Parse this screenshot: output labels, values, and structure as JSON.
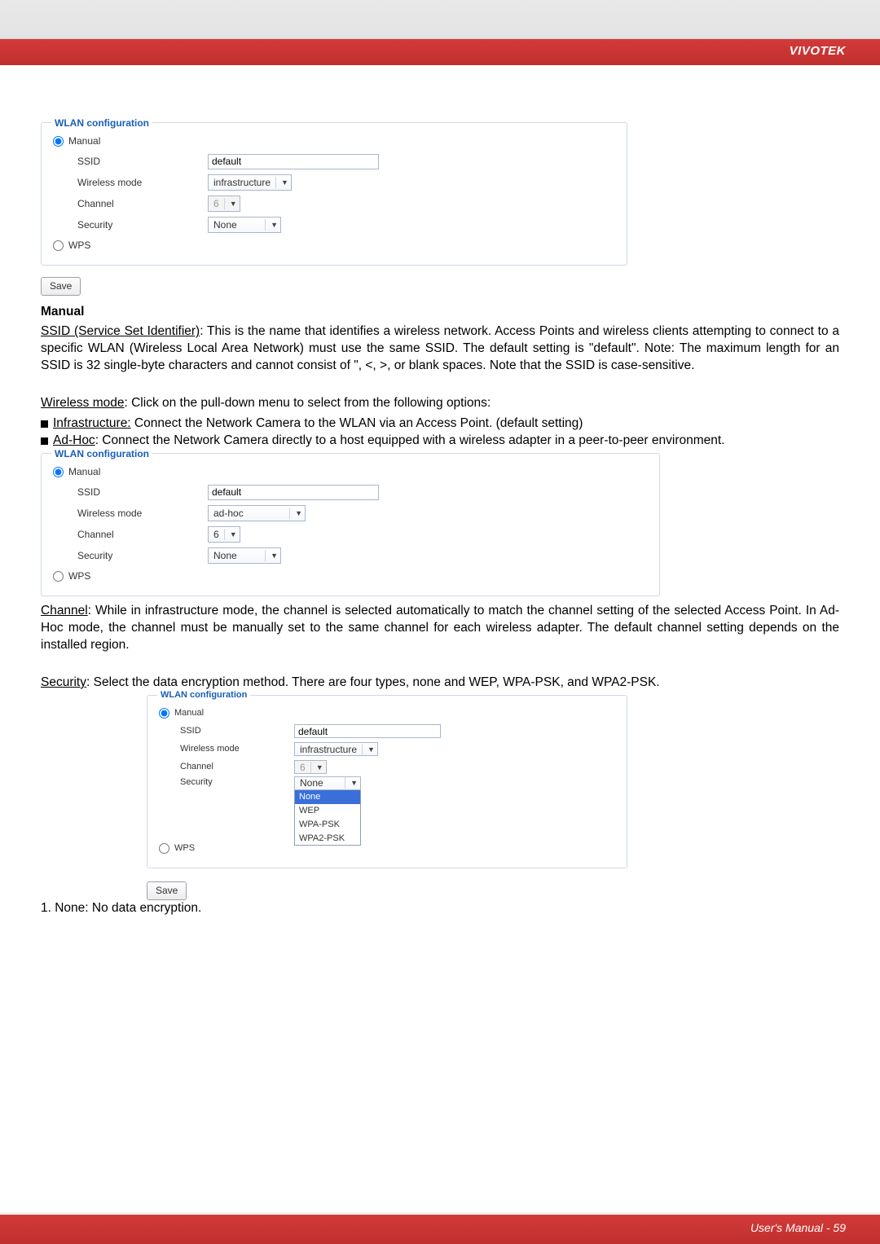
{
  "header": {
    "brand": "VIVOTEK"
  },
  "footer": {
    "text": "User's Manual - 59"
  },
  "wlan": {
    "legend": "WLAN configuration",
    "manual_label": "Manual",
    "wps_label": "WPS",
    "ssid_label": "SSID",
    "wmode_label": "Wireless mode",
    "channel_label": "Channel",
    "security_label": "Security",
    "ssid_value": "default",
    "wmode_infra": "infrastructure",
    "wmode_adhoc": "ad-hoc",
    "channel_value": "6",
    "security_value": "None",
    "save_label": "Save",
    "security_options": [
      "None",
      "WEP",
      "WPA-PSK",
      "WPA2-PSK"
    ]
  },
  "text": {
    "manual_h": "Manual",
    "ssid_term": "SSID (Service Set Identifier)",
    "ssid_body": ": This is the name that identifies a wireless network. Access Points and wireless clients attempting to connect to a specific WLAN (Wireless Local Area Network) must use the same SSID. The default setting is \"default\". Note: The maximum length for an SSID is 32 single-byte characters and cannot consist of \", <, >, or blank spaces. Note that the SSID is case-sensitive.",
    "wmode_term": "Wireless mode",
    "wmode_body": ": Click on the pull-down menu to select from the following options:",
    "infra_term": "Infrastructure:",
    "infra_body": " Connect the Network Camera to the WLAN via an Access Point. (default setting)",
    "adhoc_term": "Ad-Hoc",
    "adhoc_body": ": Connect the Network Camera directly to a host equipped with a wireless adapter in a peer-to-peer environment.",
    "channel_term": "Channel",
    "channel_body": ": While in infrastructure mode, the channel is selected automatically to match the channel setting of the selected Access Point. In Ad-Hoc mode, the channel must be manually set to the same channel for each wireless adapter. The default channel setting depends on the installed region.",
    "security_term": "Security",
    "security_body": ": Select the data encryption method. There are four types, none and WEP, WPA-PSK, and WPA2-PSK.",
    "none_item": "1. None: No data encryption."
  }
}
